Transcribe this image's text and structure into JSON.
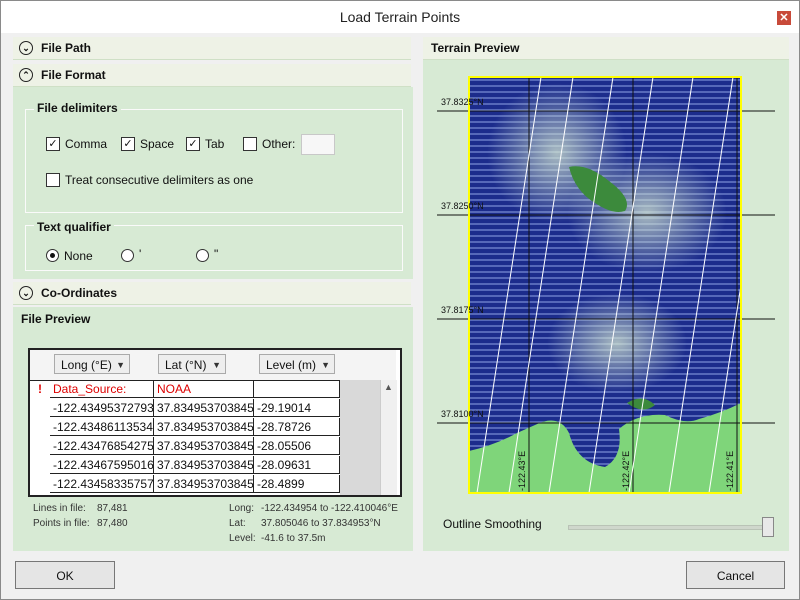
{
  "window": {
    "title": "Load Terrain Points",
    "close_glyph": "✕"
  },
  "sections": {
    "file_path": "File Path",
    "file_format": "File Format",
    "coordinates": "Co-Ordinates",
    "file_preview": "File Preview"
  },
  "file_delimiters": {
    "title": "File delimiters",
    "comma": {
      "label": "Comma",
      "checked": true
    },
    "space": {
      "label": "Space",
      "checked": true
    },
    "tab": {
      "label": "Tab",
      "checked": true
    },
    "other": {
      "label": "Other:",
      "checked": false,
      "value": ""
    },
    "consecutive": {
      "label": "Treat consecutive delimiters as one",
      "checked": false
    }
  },
  "text_qualifier": {
    "title": "Text qualifier",
    "options": [
      {
        "label": "None",
        "selected": true
      },
      {
        "label": "'",
        "selected": false
      },
      {
        "label": "\"",
        "selected": false
      }
    ]
  },
  "preview_table": {
    "columns": [
      "Long (°E)",
      "Lat (°N)",
      "Level (m)"
    ],
    "header_row": {
      "marker": "!",
      "cells": [
        "Data_Source:",
        "NOAA",
        ""
      ]
    },
    "rows": [
      [
        "-122.43495372793",
        "37.834953703845",
        "-29.19014"
      ],
      [
        "-122.43486113534",
        "37.834953703845",
        "-28.78726"
      ],
      [
        "-122.43476854275",
        "37.834953703845",
        "-28.05506"
      ],
      [
        "-122.43467595016",
        "37.834953703845",
        "-28.09631"
      ],
      [
        "-122.43458335757",
        "37.834953703845",
        "-28.4899"
      ]
    ]
  },
  "stats": {
    "lines_label": "Lines in file:",
    "lines_value": "87,481",
    "points_label": "Points in file:",
    "points_value": "87,480",
    "long_label": "Long:",
    "long_value": "-122.434954 to -122.410046°E",
    "lat_label": "Lat:",
    "lat_value": "37.805046 to 37.834953°N",
    "level_label": "Level:",
    "level_value": "-41.6 to 37.5m"
  },
  "terrain_preview": {
    "title": "Terrain Preview",
    "lat_labels": [
      "37.8325°N",
      "37.8250°N",
      "37.8175°N",
      "37.8100°N"
    ],
    "long_labels": [
      "-122.43°E",
      "-122.42°E",
      "-122.41°E"
    ],
    "colors": {
      "water": "#1c2c8c",
      "land": "#7fd57a",
      "frame": "#ffff00"
    }
  },
  "outline_smoothing": {
    "label": "Outline Smoothing",
    "value": 1.0
  },
  "buttons": {
    "ok": "OK",
    "cancel": "Cancel"
  }
}
